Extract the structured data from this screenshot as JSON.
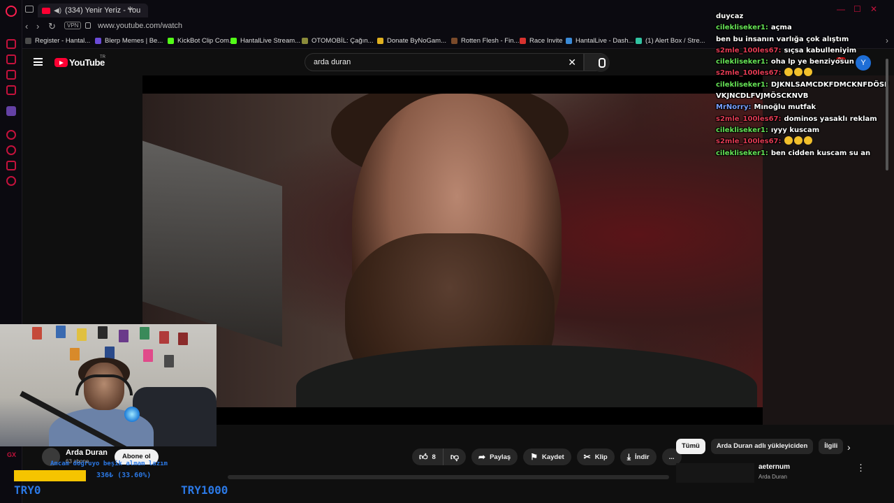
{
  "browser": {
    "tab_title": "(334) Yenir Yeriz - You",
    "url": "www.youtube.com/watch",
    "vpn_label": "VPN",
    "new_tab_label": "+",
    "accent_color": "#fa1e4e",
    "sidebar_label": "GX",
    "bookmarks": [
      {
        "label": "Register - Hantal...",
        "color": "#4a4a4a"
      },
      {
        "label": "Blerp Memes | Be...",
        "color": "#6b4bd8"
      },
      {
        "label": "KickBot Clip Com...",
        "color": "#53fc18"
      },
      {
        "label": "HantalLive Stream...",
        "color": "#53fc18"
      },
      {
        "label": "OTOMOBİL: Çağın...",
        "color": "#8a8a3a"
      },
      {
        "label": "Donate ByNoGam...",
        "color": "#e0b020"
      },
      {
        "label": "Rotten Flesh - Fin...",
        "color": "#7a4a2a"
      },
      {
        "label": "Race Invite",
        "color": "#d8322f"
      },
      {
        "label": "HantalLive - Dash...",
        "color": "#3a8ad8"
      },
      {
        "label": "(1) Alert Box / Stre...",
        "color": "#31c3a2"
      }
    ]
  },
  "youtube": {
    "logo_text": "YouTube",
    "region": "TR",
    "search_query": "arda duran",
    "notification_count": "9+",
    "avatar_letter": "Y",
    "channel": {
      "name": "Arda Duran",
      "subscribers": "63 abone",
      "subscribe_label": "Abone ol"
    },
    "actions": {
      "like_count": "8",
      "share_label": "Paylaş",
      "save_label": "Kaydet",
      "clip_label": "Klip",
      "download_label": "İndir",
      "more_label": "..."
    },
    "chips": [
      "Tümü",
      "Arda Duran adlı yükleyiciden",
      "İlgili"
    ],
    "recommendation": {
      "title": "aeternum",
      "author": "Arda Duran"
    }
  },
  "stream_overlay": {
    "donation_message": "Amcam doğruyo beşik almam lazım",
    "goal": {
      "current_label": "336₺ (33.60%)",
      "progress": 0.336,
      "min_label": "TRY0",
      "max_label": "TRY1000"
    },
    "chat": [
      {
        "user": "",
        "color": "#ffffff",
        "text": "duycaz"
      },
      {
        "user": "cilekliseker1:",
        "color": "#65e255",
        "text": "açma"
      },
      {
        "user": "",
        "color": "#ffffff",
        "text": "ben bu insanın varlığa çok alıştım"
      },
      {
        "user": "s2mle_100les67:",
        "color": "#e03a52",
        "text": "sıçsa kabulleniyim"
      },
      {
        "user": "cilekliseker1:",
        "color": "#65e255",
        "text": "oha lp ye benziyosun"
      },
      {
        "user": "s2mle_100les67:",
        "color": "#e03a52",
        "text": "",
        "emoji": 3
      },
      {
        "user": "cilekliseker1:",
        "color": "#65e255",
        "text": "DJKNLSAMCDKFDMCKNFDÖSFVKJNCDLFVJMÖSCKNVB"
      },
      {
        "user": "MrNorry:",
        "color": "#7aa0ff",
        "text": "Mınoğlu mutfak"
      },
      {
        "user": "s2mle_100les67:",
        "color": "#e03a52",
        "text": "dominos yasaklı reklam"
      },
      {
        "user": "cilekliseker1:",
        "color": "#65e255",
        "text": "ıyyy kuscam"
      },
      {
        "user": "s2mle_100les67:",
        "color": "#e03a52",
        "text": "",
        "emoji": 3
      },
      {
        "user": "cilekliseker1:",
        "color": "#65e255",
        "text": "ben cidden kuscam su an"
      }
    ]
  }
}
